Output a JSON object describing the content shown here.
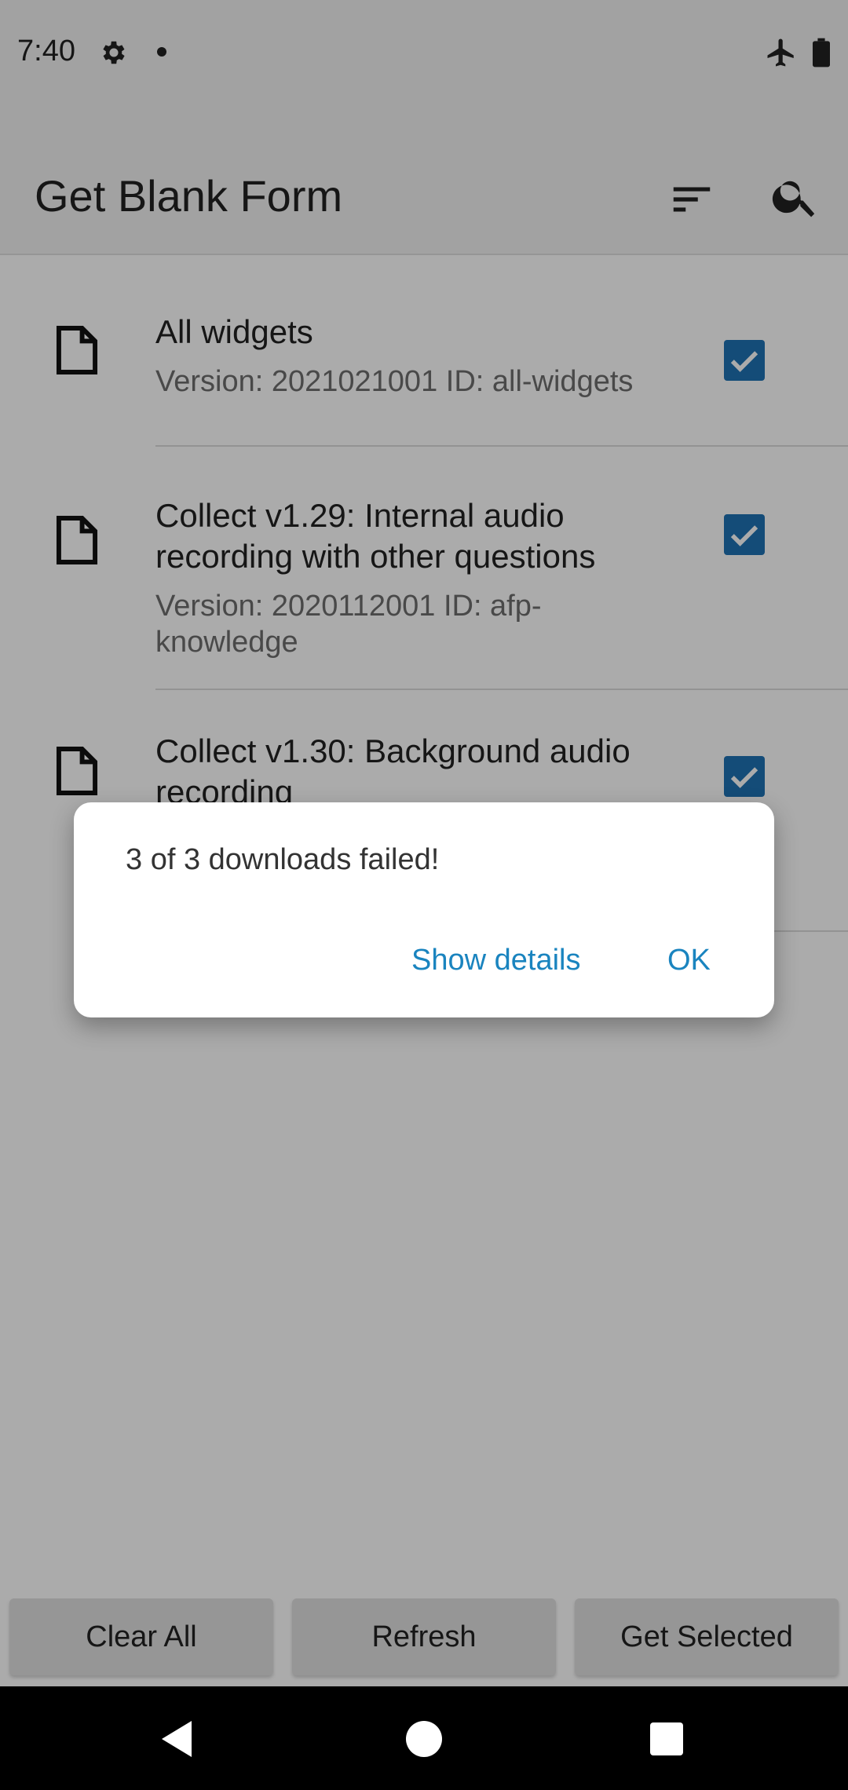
{
  "status_bar": {
    "time": "7:40"
  },
  "app_bar": {
    "title": "Get Blank Form"
  },
  "forms": [
    {
      "name": "All widgets",
      "meta": "Version: 2021021001 ID: all-widgets",
      "checked": true
    },
    {
      "name": "Collect v1.29: Internal audio recording with other questions",
      "meta": "Version: 2020112001 ID: afp-knowledge",
      "checked": true
    },
    {
      "name": "Collect v1.30: Background audio recording",
      "meta": "",
      "checked": true
    }
  ],
  "buttons": {
    "clear_all": "Clear All",
    "refresh": "Refresh",
    "get_selected": "Get Selected"
  },
  "dialog": {
    "message": "3 of 3 downloads failed!",
    "show_details": "Show details",
    "ok": "OK"
  },
  "colors": {
    "accent": "#1a84bf",
    "checkbox": "#1f72b3"
  }
}
